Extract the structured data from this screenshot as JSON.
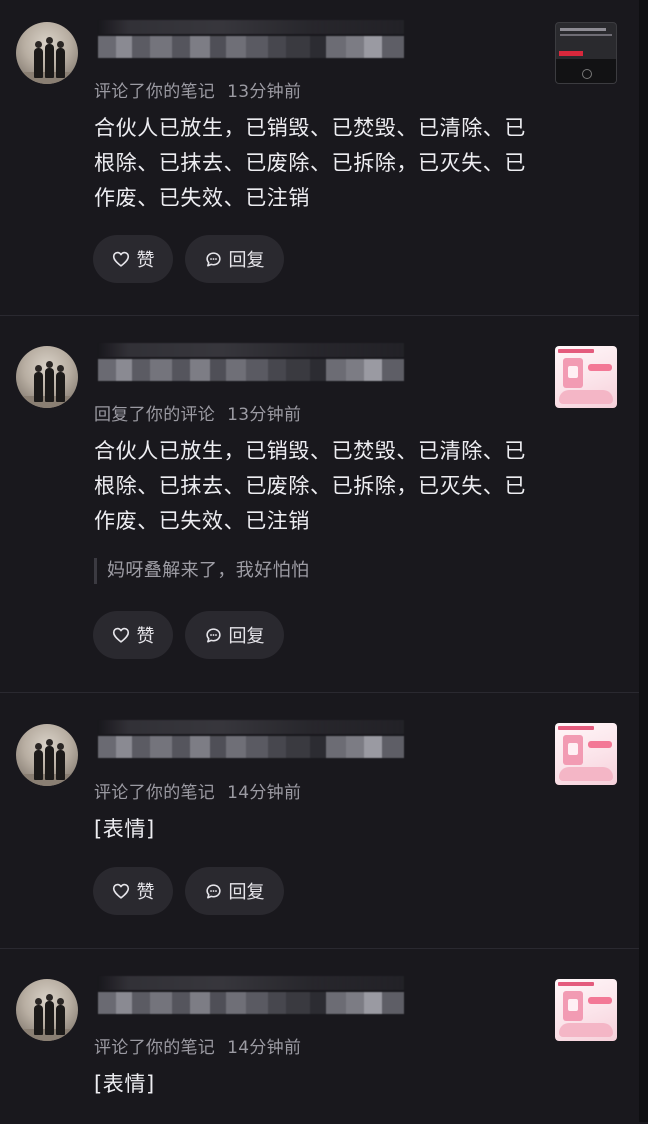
{
  "buttons": {
    "like_label": "赞",
    "reply_label": "回复"
  },
  "notifications": [
    {
      "action": "评论了你的笔记",
      "time": "13分钟前",
      "content": "合伙人已放生，已销毁、已焚毁、已清除、已根除、已抹去、已废除、已拆除，已灭失、已作废、已失效、已注销",
      "quote": "",
      "thumbnail_style": "dark"
    },
    {
      "action": "回复了你的评论",
      "time": "13分钟前",
      "content": "合伙人已放生，已销毁、已焚毁、已清除、已根除、已抹去、已废除、已拆除，已灭失、已作废、已失效、已注销",
      "quote": "妈呀叠解来了，我好怕怕",
      "thumbnail_style": "pink"
    },
    {
      "action": "评论了你的笔记",
      "time": "14分钟前",
      "content": "[表情]",
      "quote": "",
      "thumbnail_style": "pink"
    },
    {
      "action": "评论了你的笔记",
      "time": "14分钟前",
      "content": "[表情]",
      "quote": "",
      "thumbnail_style": "pink"
    }
  ],
  "colors": {
    "background": "#19181d",
    "button_bg": "#2a292f",
    "meta_text": "#9b9aa2"
  },
  "icons": {
    "like": "heart-outline-icon",
    "reply": "chat-bubble-icon"
  }
}
